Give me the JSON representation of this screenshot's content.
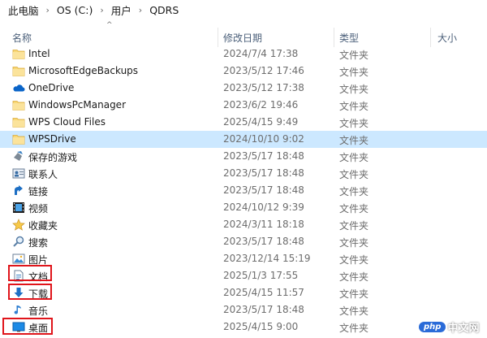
{
  "breadcrumb": [
    "此电脑",
    "OS (C:)",
    "用户",
    "QDRS"
  ],
  "breadcrumb_separator": "›",
  "columns": {
    "name": "名称",
    "date": "修改日期",
    "type": "类型",
    "size": "大小",
    "sort_indicator": "^"
  },
  "rows": [
    {
      "name": "Intel",
      "date": "2024/7/4 17:38",
      "type": "文件夹",
      "icon": "folder-icon"
    },
    {
      "name": "MicrosoftEdgeBackups",
      "date": "2023/5/12 17:46",
      "type": "文件夹",
      "icon": "folder-icon"
    },
    {
      "name": "OneDrive",
      "date": "2023/5/12 17:38",
      "type": "文件夹",
      "icon": "onedrive-icon"
    },
    {
      "name": "WindowsPcManager",
      "date": "2023/6/2 19:46",
      "type": "文件夹",
      "icon": "folder-icon"
    },
    {
      "name": "WPS Cloud Files",
      "date": "2025/4/15 9:49",
      "type": "文件夹",
      "icon": "folder-icon"
    },
    {
      "name": "WPSDrive",
      "date": "2024/10/10 9:02",
      "type": "文件夹",
      "icon": "folder-icon",
      "selected": true
    },
    {
      "name": "保存的游戏",
      "date": "2023/5/17 18:48",
      "type": "文件夹",
      "icon": "saved-games-icon"
    },
    {
      "name": "联系人",
      "date": "2023/5/17 18:48",
      "type": "文件夹",
      "icon": "contacts-icon"
    },
    {
      "name": "链接",
      "date": "2023/5/17 18:48",
      "type": "文件夹",
      "icon": "links-icon"
    },
    {
      "name": "视频",
      "date": "2024/10/12 9:39",
      "type": "文件夹",
      "icon": "videos-icon"
    },
    {
      "name": "收藏夹",
      "date": "2024/3/11 18:18",
      "type": "文件夹",
      "icon": "favorites-icon"
    },
    {
      "name": "搜索",
      "date": "2023/5/17 18:48",
      "type": "文件夹",
      "icon": "searches-icon"
    },
    {
      "name": "图片",
      "date": "2023/12/14 15:19",
      "type": "文件夹",
      "icon": "pictures-icon"
    },
    {
      "name": "文档",
      "date": "2025/1/3 17:55",
      "type": "文件夹",
      "icon": "documents-icon",
      "highlight": true
    },
    {
      "name": "下载",
      "date": "2025/4/15 11:57",
      "type": "文件夹",
      "icon": "downloads-icon",
      "highlight": true
    },
    {
      "name": "音乐",
      "date": "2023/5/17 18:48",
      "type": "文件夹",
      "icon": "music-icon"
    },
    {
      "name": "桌面",
      "date": "2025/4/15 9:00",
      "type": "文件夹",
      "icon": "desktop-icon",
      "highlight": true
    }
  ],
  "colors": {
    "selection": "#cce8ff",
    "highlight_box": "#e0151b",
    "folder": "#f8d775",
    "accent": "#0a64c8"
  },
  "watermark": {
    "pill": "php",
    "text": "中文网"
  }
}
